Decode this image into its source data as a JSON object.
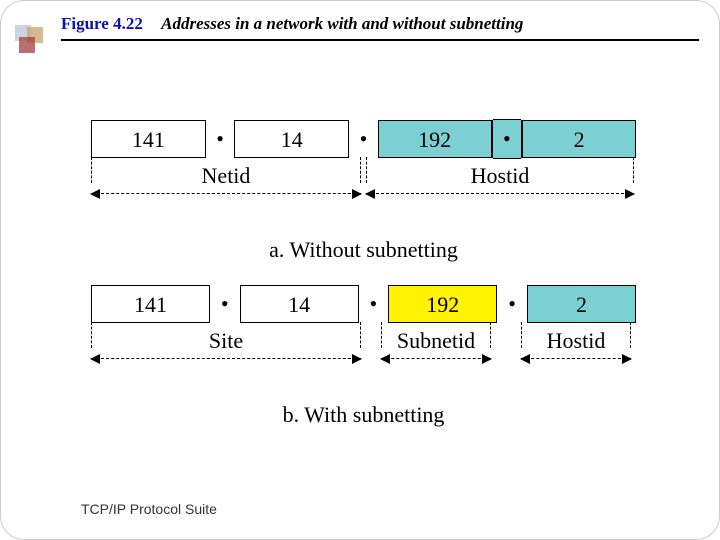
{
  "figure_label": "Figure 4.22",
  "figure_title": "Addresses in a network with and without subnetting",
  "panelA": {
    "octets": [
      "141",
      "14",
      "192",
      "2"
    ],
    "segments": [
      {
        "label": "Netid"
      },
      {
        "label": "Hostid"
      }
    ],
    "caption": "a. Without subnetting"
  },
  "panelB": {
    "octets": [
      "141",
      "14",
      "192",
      "2"
    ],
    "segments": [
      {
        "label": "Site"
      },
      {
        "label": "Subnetid"
      },
      {
        "label": "Hostid"
      }
    ],
    "caption": "b. With subnetting"
  },
  "dot": "•",
  "footer": "TCP/IP Protocol Suite"
}
